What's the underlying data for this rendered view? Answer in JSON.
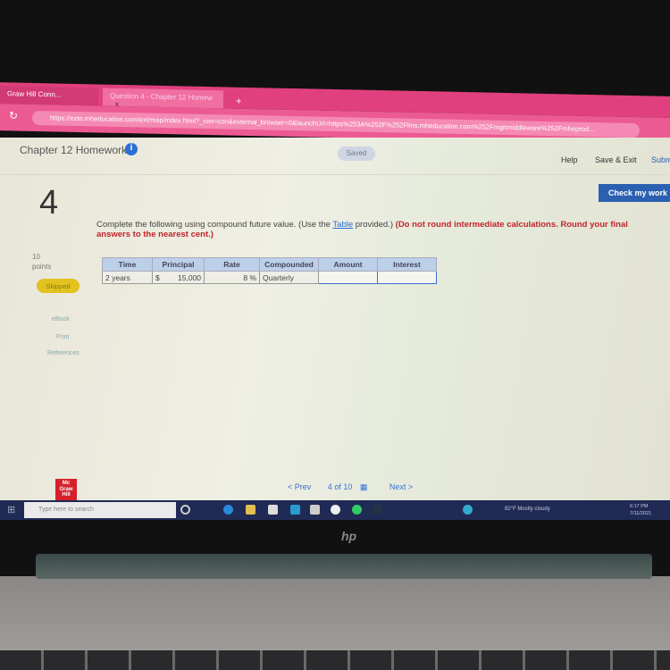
{
  "browser": {
    "tabs": [
      {
        "label": "Graw Hill Conn..."
      },
      {
        "label": "Question 4 - Chapter 12 Homew"
      }
    ],
    "tab_close": "x",
    "new_tab": "+",
    "url": "https://ezto.mheducation.com/ext/map/index.html?_con=con&external_browser=0&launchUrl=https%253A%252F%252Flms.mheducation.com%252Fmghmiddleware%252Fmheprod..."
  },
  "header": {
    "title": "Chapter 12 Homework",
    "info": "i",
    "saved": "Saved",
    "help": "Help",
    "save_exit": "Save & Exit",
    "submit": "Subm"
  },
  "question": {
    "number": "4",
    "check_label": "Check my work",
    "points_value": "10",
    "points_label": "points",
    "status": "Skipped",
    "links": [
      "eBook",
      "Print",
      "References"
    ],
    "text_prefix": "Complete the following using compound future value. (Use the ",
    "table_link": "Table",
    "text_mid": " provided.) ",
    "instruction": "(Do not round intermediate calculations. Round your final answers to the nearest cent.)"
  },
  "table": {
    "headers": [
      "Time",
      "Principal",
      "Rate",
      "Compounded",
      "Amount",
      "Interest"
    ],
    "row": {
      "time": "2 years",
      "currency": "$",
      "principal": "15,000",
      "rate": "8",
      "rate_unit": "%",
      "compounded": "Quarterly",
      "amount": "",
      "interest": ""
    }
  },
  "footer": {
    "logo": "Mc Graw Hill",
    "prev": "< Prev",
    "page": "4",
    "of": "of 10",
    "next": "Next >"
  },
  "taskbar": {
    "search_placeholder": "Type here to search",
    "weather": "82°F  Mostly cloudy",
    "time": "6:17 PM",
    "date": "7/11/2021"
  },
  "laptop": {
    "brand": "hp"
  }
}
